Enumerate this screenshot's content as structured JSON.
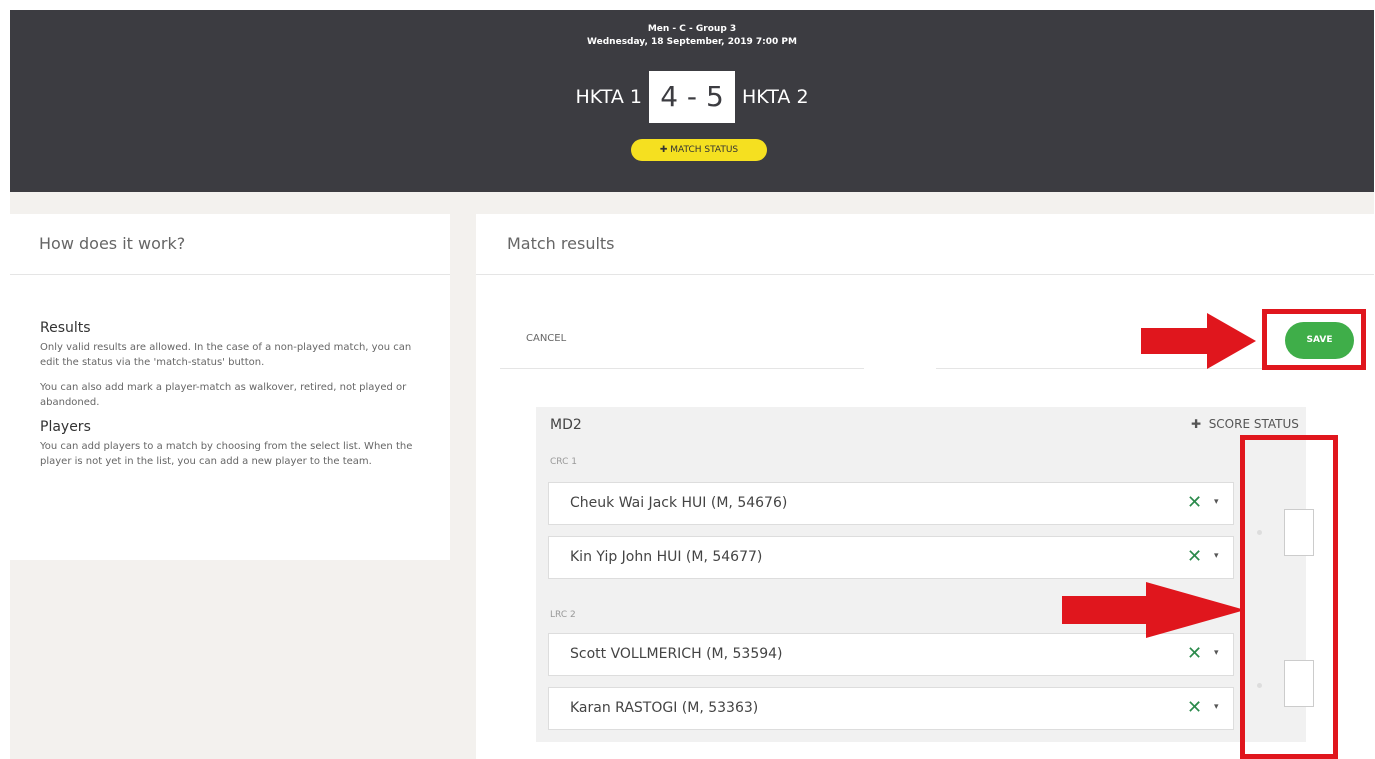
{
  "header": {
    "category": "Men - C - Group 3",
    "date": "Wednesday, 18 September, 2019 7:00 PM",
    "home_team": "HKTA 1",
    "score": "4 - 5",
    "away_team": "HKTA 2",
    "match_status_label": "MATCH STATUS"
  },
  "help": {
    "title": "How does it work?",
    "results_heading": "Results",
    "results_text_1": "Only valid results are allowed. In the case of a non-played match, you can edit the status via the 'match-status' button.",
    "results_text_2": "You can also add mark a player-match as walkover, retired, not played or abandoned.",
    "players_heading": "Players",
    "players_text": "You can add players to a match by choosing from the select list. When the player is not yet in the list, you can add a new player to the team."
  },
  "results": {
    "title": "Match results",
    "cancel_label": "CANCEL",
    "save_label": "SAVE",
    "match_name": "MD2",
    "score_status_label": "SCORE STATUS",
    "team1_label": "CRC 1",
    "team2_label": "LRC 2",
    "players": [
      "Cheuk Wai Jack HUI (M, 54676)",
      "Kin Yip John HUI (M, 54677)",
      "Scott VOLLMERICH (M, 53594)",
      "Karan RASTOGI (M, 53363)"
    ],
    "clear_glyph": "✕",
    "dropdown_glyph": "▾"
  },
  "colors": {
    "header_bg": "#3c3c41",
    "match_status_bg": "#f5e020",
    "save_green": "#3fae49",
    "annotation_red": "#e0161d",
    "clear_green": "#2b8a4b"
  }
}
